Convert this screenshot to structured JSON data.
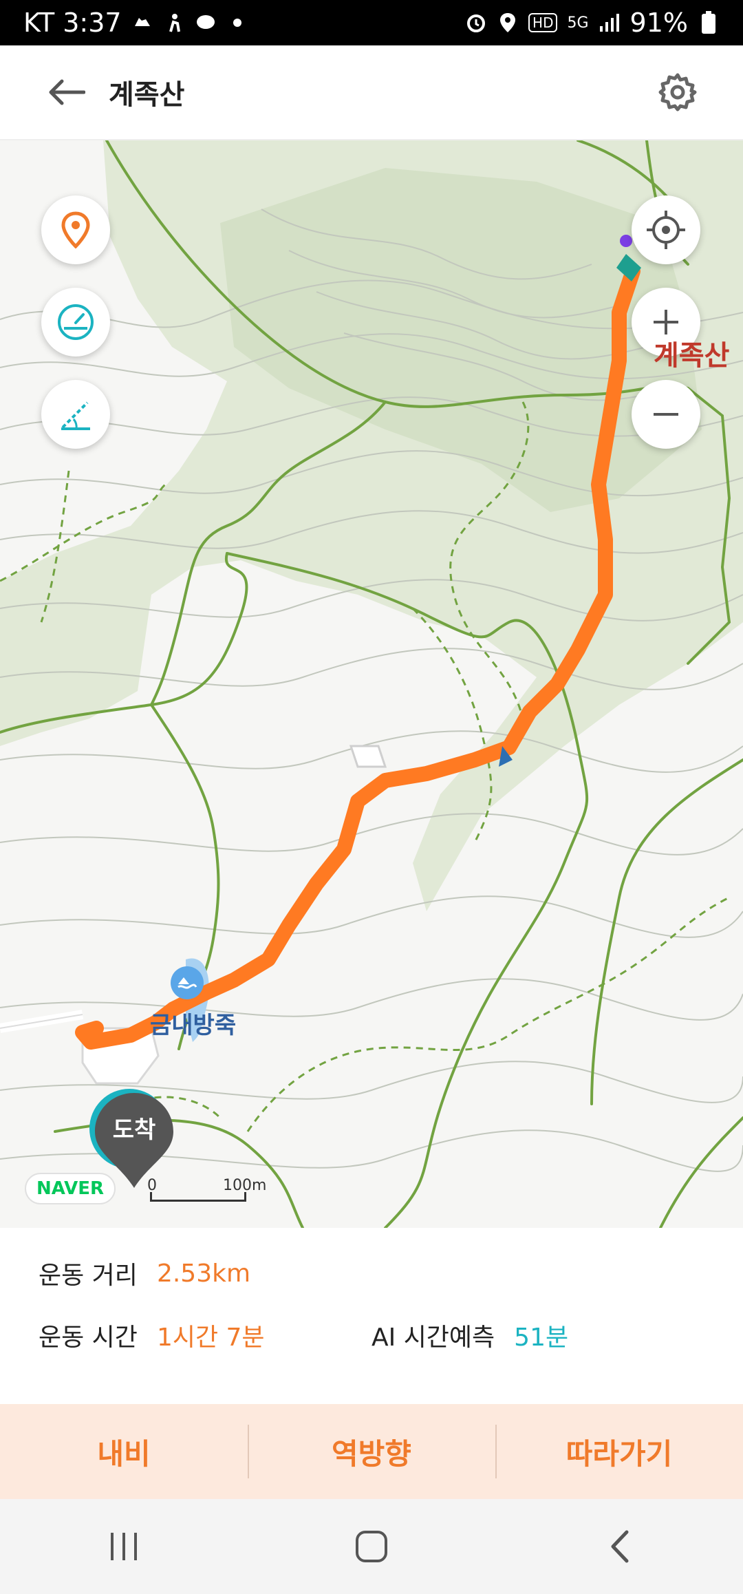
{
  "status_bar": {
    "carrier_time": "KT 3:37",
    "network": "5G",
    "hd_label": "HD",
    "battery": "91%"
  },
  "header": {
    "back_icon": "arrow-left-icon",
    "title": "계족산",
    "settings_icon": "gear-icon"
  },
  "map": {
    "buttons": {
      "place_marker": "location-pin-icon",
      "speed_meter": "speedometer-icon",
      "slope": "incline-icon",
      "locate": "crosshair-icon",
      "zoom_in": "plus-icon",
      "zoom_out": "minus-icon"
    },
    "labels": {
      "peak": "계족산",
      "reservoir": "금내방죽"
    },
    "arrival_marker": "도착",
    "provider": "NAVER",
    "scale": {
      "zero": "0",
      "distance": "100m"
    },
    "colors": {
      "route": "#ff7a22",
      "contour": "#b5b5b5",
      "trail": "#6c9f3a",
      "forest": "#dfe8d3"
    }
  },
  "info": {
    "distance_label": "운동 거리",
    "distance_value": "2.53km",
    "time_label": "운동 시간",
    "time_value": "1시간 7분",
    "ai_label": "AI 시간예측",
    "ai_value": "51분"
  },
  "actions": {
    "navi": "내비",
    "reverse": "역방향",
    "follow": "따라가기"
  },
  "nav_bar": {
    "recent": "recent-apps-icon",
    "home": "home-icon",
    "back": "back-chevron-icon"
  }
}
